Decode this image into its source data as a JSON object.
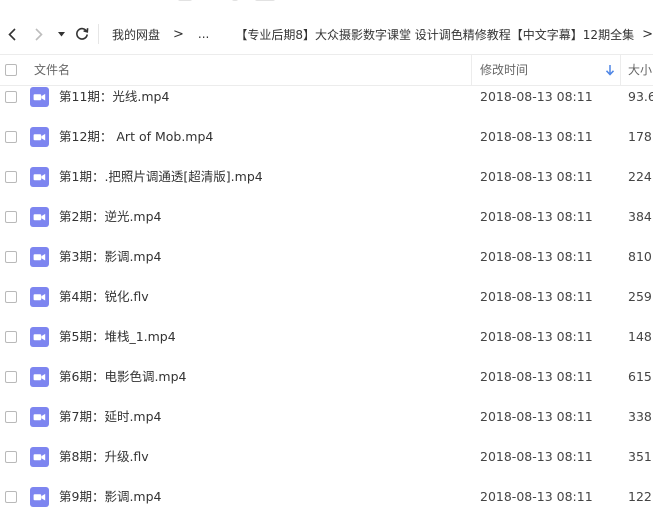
{
  "nav": {
    "breadcrumb_root": "我的网盘",
    "breadcrumb_arrow": ">",
    "breadcrumb_ellipsis": "...",
    "breadcrumb_current": "【专业后期8】大众摄影数字课堂 设计调色精修教程【中文字幕】12期全集",
    "breadcrumb_end_arrow": ">"
  },
  "header": {
    "name_label": "文件名",
    "time_label": "修改时间",
    "size_label": "大小"
  },
  "colors": {
    "icon_purple": "#7d85f0",
    "sort_arrow": "#4f86e5"
  },
  "files": [
    {
      "name": "第11期：光线.mp4",
      "time": "2018-08-13 08:11",
      "size": "93.6"
    },
    {
      "name": "第12期： Art of Mob.mp4",
      "time": "2018-08-13 08:11",
      "size": "178."
    },
    {
      "name": "第1期：.把照片调通透[超清版].mp4",
      "time": "2018-08-13 08:11",
      "size": "224."
    },
    {
      "name": "第2期：逆光.mp4",
      "time": "2018-08-13 08:11",
      "size": "384."
    },
    {
      "name": "第3期：影调.mp4",
      "time": "2018-08-13 08:11",
      "size": "810."
    },
    {
      "name": "第4期：锐化.flv",
      "time": "2018-08-13 08:11",
      "size": "259."
    },
    {
      "name": "第5期：堆栈_1.mp4",
      "time": "2018-08-13 08:11",
      "size": "148."
    },
    {
      "name": "第6期：电影色调.mp4",
      "time": "2018-08-13 08:11",
      "size": "615."
    },
    {
      "name": "第7期：延时.mp4",
      "time": "2018-08-13 08:11",
      "size": "338."
    },
    {
      "name": "第8期：升级.flv",
      "time": "2018-08-13 08:11",
      "size": "351."
    },
    {
      "name": "第9期：影调.mp4",
      "time": "2018-08-13 08:11",
      "size": "122."
    }
  ]
}
